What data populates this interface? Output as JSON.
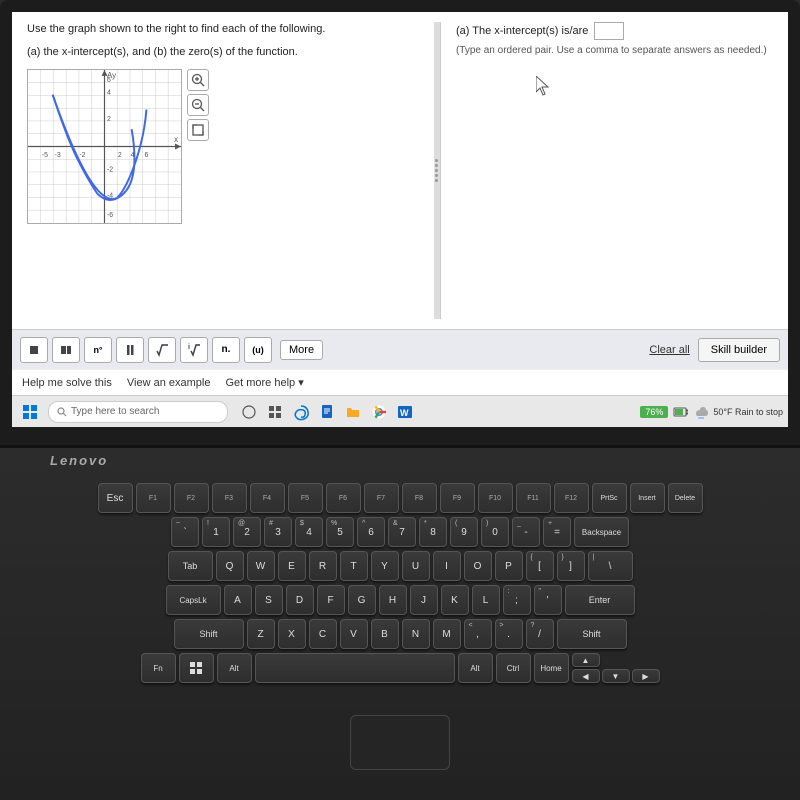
{
  "screen": {
    "problem_text_1": "Use the graph shown to the right to find each of the following.",
    "problem_text_2": "(a) the x-intercept(s), and (b) the zero(s) of the function.",
    "right_label_a": "(a) The x-intercept(s) is/are",
    "right_note": "(Type an ordered pair. Use a comma to separate answers as needed.)",
    "toolbar_buttons": [
      "■",
      "■|",
      "n°",
      "║",
      "√",
      "√i",
      "n.",
      "(u)"
    ],
    "more_label": "More",
    "clear_all_label": "Clear all",
    "skill_builder_label": "Skill builder",
    "help_me_label": "Help me solve this",
    "view_example_label": "View an example",
    "get_more_label": "Get more help ▾"
  },
  "taskbar": {
    "search_placeholder": "Type here to search",
    "battery": "76%",
    "weather": "50°F  Rain to stop"
  },
  "keyboard": {
    "lenovo_label": "Lenovo",
    "row1": [
      "Esc",
      "F1",
      "F2",
      "F3",
      "F4",
      "F5",
      "F6",
      "F7",
      "F8",
      "F9",
      "F10",
      "F11",
      "F12",
      "PrtSc",
      "Insert",
      "Delete"
    ],
    "row2": [
      "~\n`",
      "!\n1",
      "@\n2",
      "#\n3",
      "$\n4",
      "%\n5",
      "^\n6",
      "&\n7",
      "*\n8",
      "(\n9",
      ")\n0",
      "_\n-",
      "+\n=",
      "Backspace"
    ],
    "row3": [
      "Tab",
      "Q",
      "W",
      "E",
      "R",
      "T",
      "Y",
      "U",
      "I",
      "O",
      "P",
      "{\n[",
      "}\n]",
      "|\n\\"
    ],
    "row4": [
      "CapsLk",
      "A",
      "S",
      "D",
      "F",
      "G",
      "H",
      "J",
      "K",
      "L",
      ":\n;",
      "\"\n'",
      "Enter"
    ],
    "row5": [
      "Shift",
      "Z",
      "X",
      "C",
      "V",
      "B",
      "N",
      "M",
      "<\n,",
      ">\n.",
      "?\n/",
      "Shift"
    ],
    "row6": [
      "Fn",
      "Win",
      "Alt",
      "Space",
      "Alt",
      "Ctrl",
      "Home"
    ]
  }
}
